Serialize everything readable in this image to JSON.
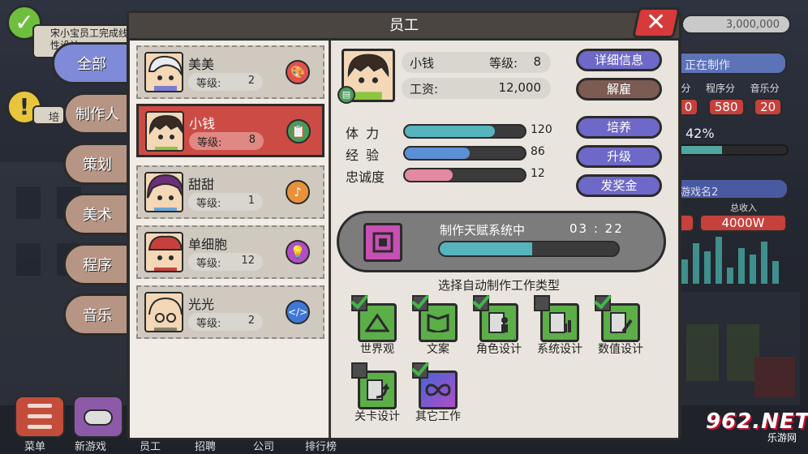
{
  "background": {
    "coins": "3,000,000",
    "note_text": "宋小宝员工完成线性设计",
    "note2_text": "培",
    "producing_label": "正在制作",
    "scores_labels": [
      "分",
      "程序分",
      "音乐分"
    ],
    "scores_values": [
      "0",
      "580",
      "20"
    ],
    "progress_pct": "42%",
    "progress_value": 0.42,
    "game_name": "游戏名2",
    "income_label": "总收入",
    "income_value": "4000W",
    "bottom_labels": [
      "菜单",
      "新游戏",
      "员工",
      "招聘",
      "公司",
      "排行榜"
    ],
    "watermark": "962.NET",
    "watermark_sub": "乐游网"
  },
  "tabs": [
    "全部",
    "制作人",
    "策划",
    "美术",
    "程序",
    "音乐"
  ],
  "active_tab": "全部",
  "panel": {
    "title": "员工",
    "close_icon": "close-icon"
  },
  "employees": [
    {
      "name": "美美",
      "level_label": "等级:",
      "level": "2",
      "role_icon": "palette-icon",
      "role_color": "#e0524f",
      "selected": false
    },
    {
      "name": "小钱",
      "level_label": "等级:",
      "level": "8",
      "role_icon": "clipboard-icon",
      "role_color": "#4c9b5b",
      "selected": true
    },
    {
      "name": "甜甜",
      "level_label": "等级:",
      "level": "1",
      "role_icon": "music-note-icon",
      "role_color": "#e8913a",
      "selected": false
    },
    {
      "name": "单细胞",
      "level_label": "等级:",
      "level": "12",
      "role_icon": "lightbulb-icon",
      "role_color": "#b04ec4",
      "selected": false
    },
    {
      "name": "光光",
      "level_label": "等级:",
      "level": "2",
      "role_icon": "code-icon",
      "role_color": "#3d78d8",
      "selected": false
    }
  ],
  "detail": {
    "name": "小钱",
    "level_label": "等级:",
    "level": "8",
    "salary_label": "工资:",
    "salary": "12,000",
    "buttons": {
      "details": "详细信息",
      "fire": "解雇",
      "train": "培养",
      "upgrade": "升级",
      "bonus": "发奖金"
    },
    "stats": [
      {
        "label": "体 力",
        "value": 120,
        "max": 160,
        "color": "#56b4bd"
      },
      {
        "label": "经 验",
        "value": 86,
        "max": 160,
        "color": "#5b8fd6"
      },
      {
        "label": "忠诚度",
        "value": 12,
        "max": 30,
        "color": "#e48aa0"
      }
    ],
    "talent": {
      "title": "制作天赋系统中",
      "time": "03 : 22",
      "progress": 0.52
    },
    "auto_title": "选择自动制作工作类型",
    "jobs": [
      {
        "label": "世界观",
        "checked": true,
        "icon": "mountain-icon"
      },
      {
        "label": "文案",
        "checked": true,
        "icon": "book-icon"
      },
      {
        "label": "角色设计",
        "checked": true,
        "icon": "character-icon"
      },
      {
        "label": "系统设计",
        "checked": false,
        "icon": "system-icon"
      },
      {
        "label": "数值设计",
        "checked": true,
        "icon": "numbers-icon"
      },
      {
        "label": "关卡设计",
        "checked": false,
        "icon": "level-icon"
      },
      {
        "label": "其它工作",
        "checked": true,
        "icon": "infinity-icon"
      }
    ]
  }
}
